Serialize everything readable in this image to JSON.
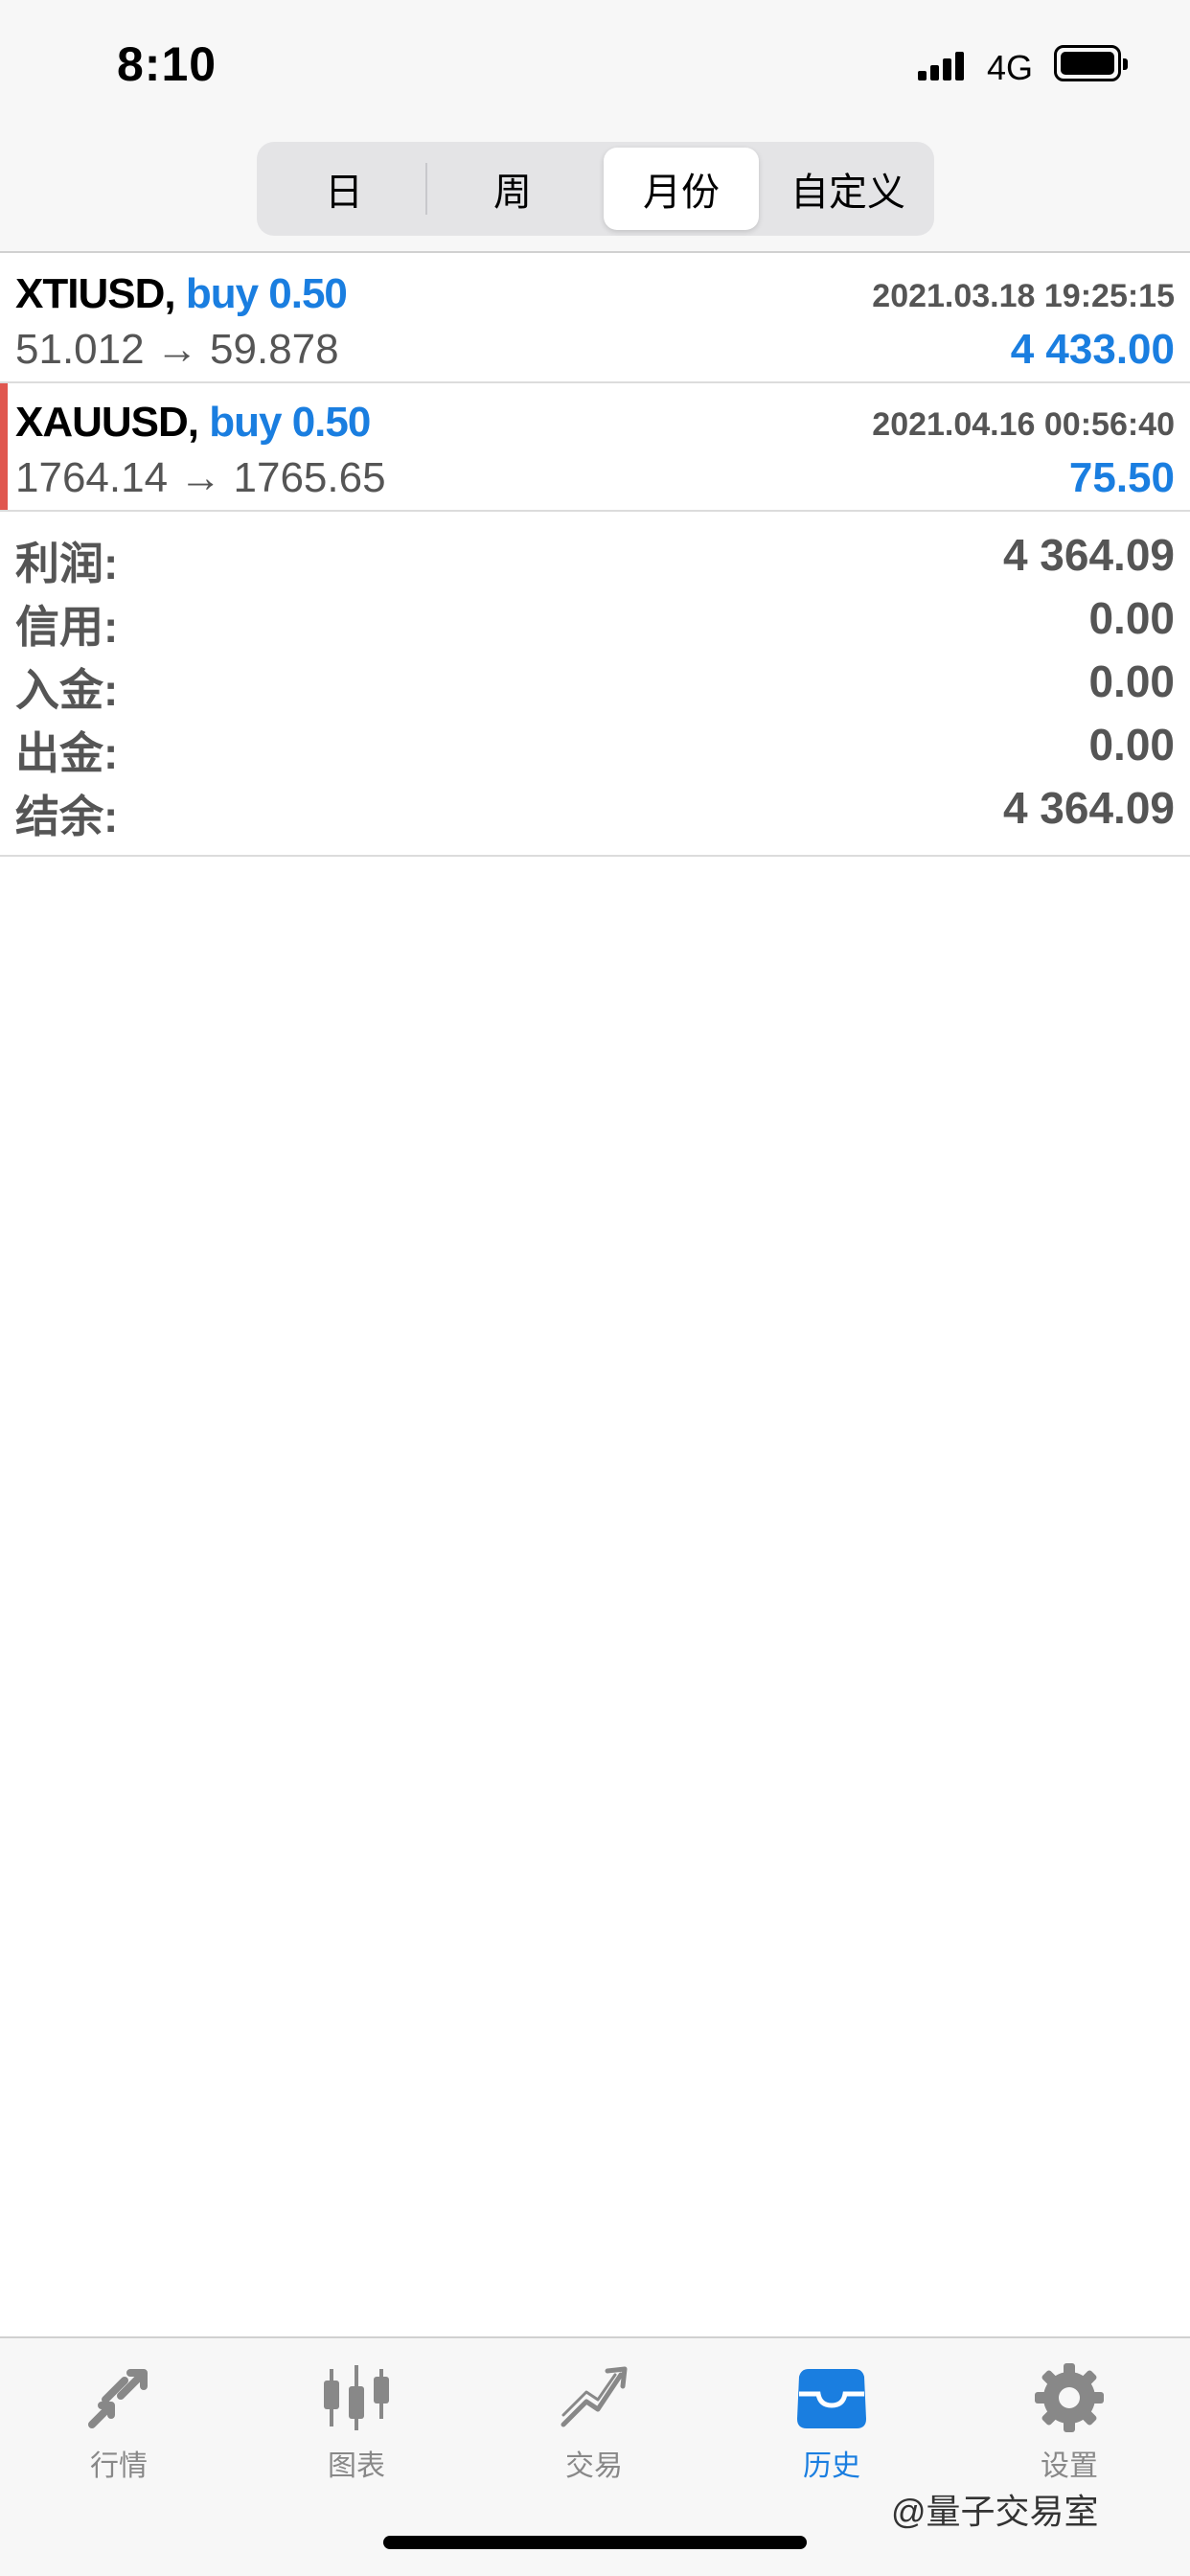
{
  "status_bar": {
    "time": "8:10",
    "network": "4G"
  },
  "period_tabs": [
    {
      "label": "日",
      "active": false
    },
    {
      "label": "周",
      "active": false
    },
    {
      "label": "月份",
      "active": true
    },
    {
      "label": "自定义",
      "active": false
    }
  ],
  "trades": [
    {
      "symbol": "XTIUSD,",
      "side": "buy 0.50",
      "datetime": "2021.03.18 19:25:15",
      "prices": "51.012 → 59.878",
      "profit": "4 433.00"
    },
    {
      "symbol": "XAUUSD,",
      "side": "buy 0.50",
      "datetime": "2021.04.16 00:56:40",
      "prices": "1764.14 → 1765.65",
      "profit": "75.50"
    }
  ],
  "summary": {
    "profit_label": "利润:",
    "profit_value": "4 364.09",
    "credit_label": "信用:",
    "credit_value": "0.00",
    "deposit_label": "入金:",
    "deposit_value": "0.00",
    "withdrawal_label": "出金:",
    "withdrawal_value": "0.00",
    "balance_label": "结余:",
    "balance_value": "4 364.09"
  },
  "tab_bar": [
    {
      "label": "行情",
      "icon": "quotes-arrows-icon",
      "active": false
    },
    {
      "label": "图表",
      "icon": "candlestick-chart-icon",
      "active": false
    },
    {
      "label": "交易",
      "icon": "trade-trend-icon",
      "active": false
    },
    {
      "label": "历史",
      "icon": "history-inbox-icon",
      "active": true
    },
    {
      "label": "设置",
      "icon": "gear-icon",
      "active": false
    }
  ],
  "watermark": "@量子交易室",
  "colors": {
    "accent": "#1a7ee0",
    "marker": "#e0574f",
    "inactive": "#888888"
  }
}
